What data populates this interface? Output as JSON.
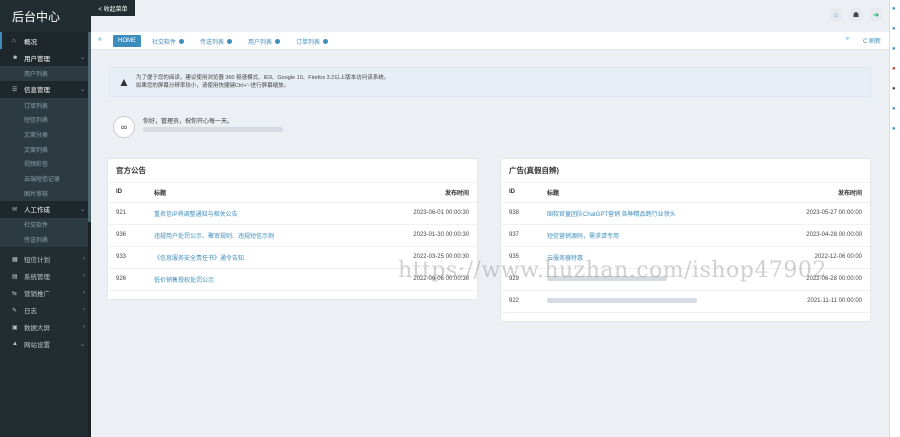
{
  "app": {
    "title": "后台中心"
  },
  "topbar": {
    "collapse_label": "< 收起菜单"
  },
  "sidebar": {
    "items": [
      {
        "label": "概况",
        "icon": "home-icon",
        "active": true
      },
      {
        "label": "用户管理",
        "icon": "users-icon",
        "expanded": true,
        "children": [
          "用户列表"
        ]
      },
      {
        "label": "信息管理",
        "icon": "list-icon",
        "expanded": true,
        "children": [
          "订单列表",
          "短信列表",
          "文案分类",
          "文案列表",
          "视频彩信",
          "云端短信记录",
          "图片审核"
        ]
      },
      {
        "label": "人工作成",
        "icon": "mail-icon",
        "expanded": true,
        "children": [
          "社交软件",
          "传送列表"
        ]
      },
      {
        "label": "短信计划",
        "icon": "calendar-icon"
      },
      {
        "label": "系统管理",
        "icon": "grid-icon"
      },
      {
        "label": "营销推广",
        "icon": "share-icon"
      },
      {
        "label": "日志",
        "icon": "log-icon"
      },
      {
        "label": "数据大屏",
        "icon": "chart-icon"
      },
      {
        "label": "网站设置",
        "icon": "settings-icon"
      }
    ]
  },
  "tabs": {
    "items": [
      "HOME",
      "社交软件",
      "传送列表",
      "用户列表",
      "订单列表"
    ],
    "active": "HOME",
    "refresh_label": "C 刷新"
  },
  "notice": {
    "line1": "为了便于您的阅读，建议使用浏览器 360 极速模式、IE9、Google 10、Firefox 3.2以上版本访问该系统。",
    "line2": "如果您的屏幕分辨率较小，请使用快捷键Ctrl+'-'进行屏幕缩放。"
  },
  "welcome": {
    "line1": "你好，管理员，祝你开心每一天。"
  },
  "announcements": {
    "title": "官方公告",
    "columns": [
      "ID",
      "标题",
      "发布时间"
    ],
    "rows": [
      {
        "id": "921",
        "title": "重名信IP将调整通知与相关公告",
        "time": "2023-06-01 00:00:30"
      },
      {
        "id": "936",
        "title": "违规用户处罚公示、聚审规则、违规短信示例",
        "time": "2023-01-30 00:00:30"
      },
      {
        "id": "933",
        "title": "《信息服务安全责任书》通令告知",
        "time": "2022-03-25 00:00:30"
      },
      {
        "id": "926",
        "title": "低价销售授权处罚公示",
        "time": "2022-06-06 00:00:30"
      }
    ]
  },
  "ads": {
    "title": "广告(真假自辨)",
    "columns": [
      "ID",
      "标题",
      "发布时间"
    ],
    "rows": [
      {
        "id": "938",
        "title": "国软官童团队ChatGPT营销 各种精品跨行业领头",
        "time": "2023-05-27 00:00:00"
      },
      {
        "id": "937",
        "title": "短信营销源码，需求请专用",
        "time": "2023-04-28 00:00:00"
      },
      {
        "id": "935",
        "title": "云服务器特惠",
        "time": "2022-12-06 00:00"
      },
      {
        "id": "929",
        "title": "",
        "time": "2022-06-28 00:00:00"
      },
      {
        "id": "922",
        "title": "",
        "time": "2021-11-11 00:00:00"
      }
    ]
  },
  "watermark": "https://www.huzhan.com/ishop47902"
}
